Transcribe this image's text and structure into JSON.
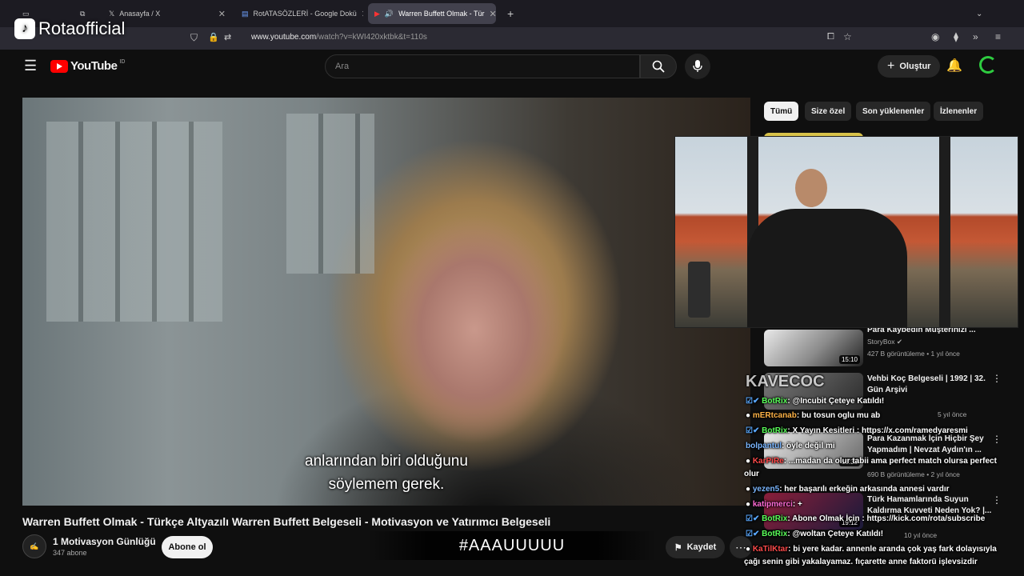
{
  "browser": {
    "tabs": [
      {
        "label": "Anasayfa / X"
      },
      {
        "label": "RotATASÖZLERİ - Google Dokü"
      },
      {
        "label": "Warren Buffett Olmak - Tür"
      }
    ],
    "url_prefix": "www.youtube.com",
    "url_rest": "/watch?v=kWI420xktbk&t=110s"
  },
  "youtube": {
    "logo_text": "YouTube",
    "logo_badge": "ID",
    "search_placeholder": "Ara",
    "create_label": "Oluştur"
  },
  "video": {
    "subtitle_line1": "anlarından biri olduğunu",
    "subtitle_line2": "söylemem gerek.",
    "title": "Warren Buffett Olmak - Türkçe Altyazılı Warren Buffett Belgeseli - Motivasyon ve Yatırımcı Belgeseli",
    "channel_name": "1 Motivasyon Günlüğü",
    "subscriber_count": "347 abone",
    "subscribe_label": "Abone ol",
    "save_label": "Kaydet"
  },
  "chips": [
    "Tümü",
    "Size özel",
    "Son yüklenenler",
    "İzlenenler"
  ],
  "recommendations": [
    {
      "title": "Para Kaybedin Müşterinizi ...",
      "channel": "StoryBox",
      "meta": "427 B görüntüleme • 1 yıl önce",
      "duration": "15:10"
    },
    {
      "title": "Vehbi Koç Belgeseli | 1992 | 32.",
      "title2": "Gün Arşivi",
      "meta": "5 yıl önce",
      "duration": ""
    },
    {
      "title": "Para Kazanmak İçin Hiçbir Şey",
      "title2": "Yapmadım | Nevzat Aydın'ın ...",
      "meta": "690 B görüntüleme • 2 yıl önce",
      "duration": "15:38"
    },
    {
      "title": "Türk Hamamlarında Suyun",
      "title2": "Kaldırma Kuvveti Neden Yok? |...",
      "meta": "10 yıl önce",
      "duration": "19:12"
    }
  ],
  "chat": [
    {
      "user": "BotRix",
      "msg": ": @Incubit Çeteye Katıldı!"
    },
    {
      "user": "mERtcanab",
      "msg": ": bu tosun oglu mu ab"
    },
    {
      "user": "BotRix",
      "msg": ": X Yayın Kesitleri : https://x.com/ramedyaresmi"
    },
    {
      "user": "bolpantul",
      "msg": ": öyle değil mi"
    },
    {
      "user": "KarPiRe",
      "msg": ": ...madan da olur tabii ama perfect match olursa perfect"
    },
    {
      "user": "olur",
      "msg": ""
    },
    {
      "user": "yezen5",
      "msg": ": her başarılı erkeğin arkasında annesi vardır"
    },
    {
      "user": "katipmerci",
      "msg": ": +"
    },
    {
      "user": "BotRix",
      "msg": ": Abone Olmak İçin : https://kick.com/rota/subscribe"
    },
    {
      "user": "BotRix",
      "msg": ": @woltan Çeteye Katıldı!"
    },
    {
      "user": "KaTilKtar",
      "msg": ": bi yere kadar. annenle aranda çok yaş fark dolayısıyla"
    },
    {
      "user": "",
      "msg": "çağı senin gibi yakalayamaz. fıçarette anne faktorü işlevsizdir"
    }
  ],
  "overlays": {
    "streamer_name": "Rotaofficial",
    "banner_text": "#AAAUUUUU",
    "small_channel_tag": "KAVECOC"
  }
}
